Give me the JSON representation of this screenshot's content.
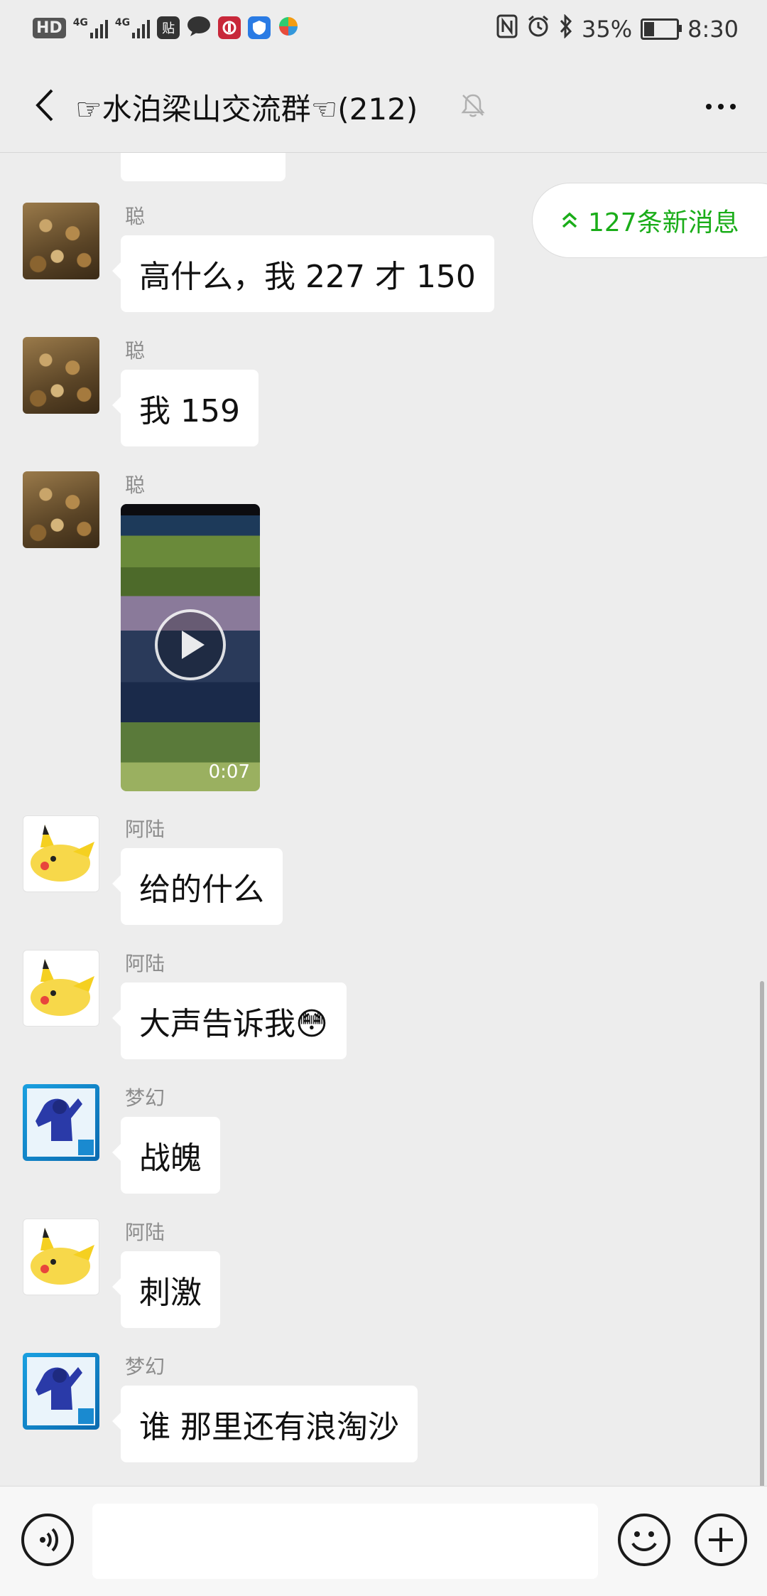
{
  "status_bar": {
    "hd": "HD",
    "net1": "4G",
    "net2": "4G",
    "app_tie": "贴",
    "battery_percent": "35%",
    "battery_level": 0.35,
    "time": "8:30"
  },
  "header": {
    "title": "☞水泊梁山交流群☜(212)"
  },
  "new_messages": {
    "label": "127条新消息"
  },
  "messages": [
    {
      "sender": "聪",
      "text": "高什么，我 227 才 150"
    },
    {
      "sender": "聪",
      "text": "我 159"
    },
    {
      "sender": "聪",
      "video_duration": "0:07"
    },
    {
      "sender": "阿陆",
      "text": "给的什么"
    },
    {
      "sender": "阿陆",
      "text": "大声告诉我😳"
    },
    {
      "sender": "梦幻",
      "text": "战魄"
    },
    {
      "sender": "阿陆",
      "text": "刺激"
    },
    {
      "sender": "梦幻",
      "text": "谁 那里还有浪淘沙"
    }
  ],
  "colors": {
    "accent_green": "#1aad19",
    "background": "#ededed",
    "bubble": "#ffffff"
  }
}
